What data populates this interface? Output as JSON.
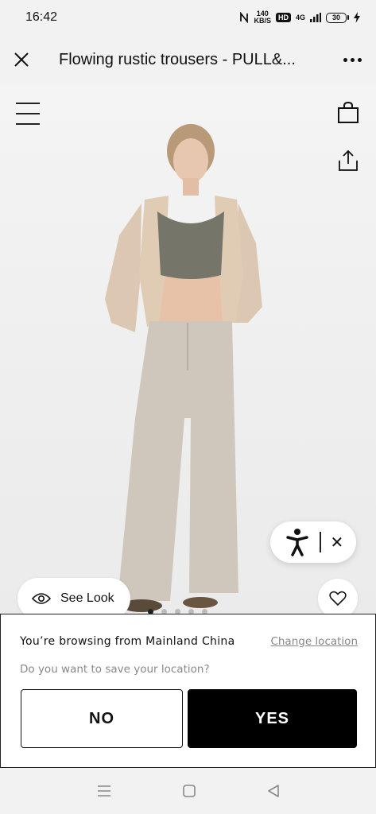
{
  "status_bar": {
    "time": "16:42",
    "speed_value": "140",
    "speed_unit": "KB/S",
    "hd_badge": "HD",
    "network": "4G",
    "battery": "30",
    "icons": [
      "nfc-icon",
      "signal-icon",
      "battery-icon",
      "charging-icon"
    ]
  },
  "browser": {
    "page_title": "Flowing rustic trousers - PULL&...",
    "close_icon": "close-icon",
    "more_icon": "more-dots-icon"
  },
  "product": {
    "menu_icon": "hamburger-menu-icon",
    "bag_icon": "shopping-bag-icon",
    "share_icon": "share-icon",
    "see_look_label": "See Look",
    "favorite_icon": "heart-icon",
    "accessibility_icon": "accessibility-icon",
    "carousel_count": 5,
    "carousel_active": 0
  },
  "location_prompt": {
    "browsing_text": "You’re browsing from Mainland China",
    "change_label": "Change location",
    "question": "Do you want to save your location?",
    "no_label": "NO",
    "yes_label": "YES"
  },
  "colors": {
    "accent": "#000000",
    "muted_text": "#888888",
    "chrome_bg": "#f2f2f2"
  }
}
